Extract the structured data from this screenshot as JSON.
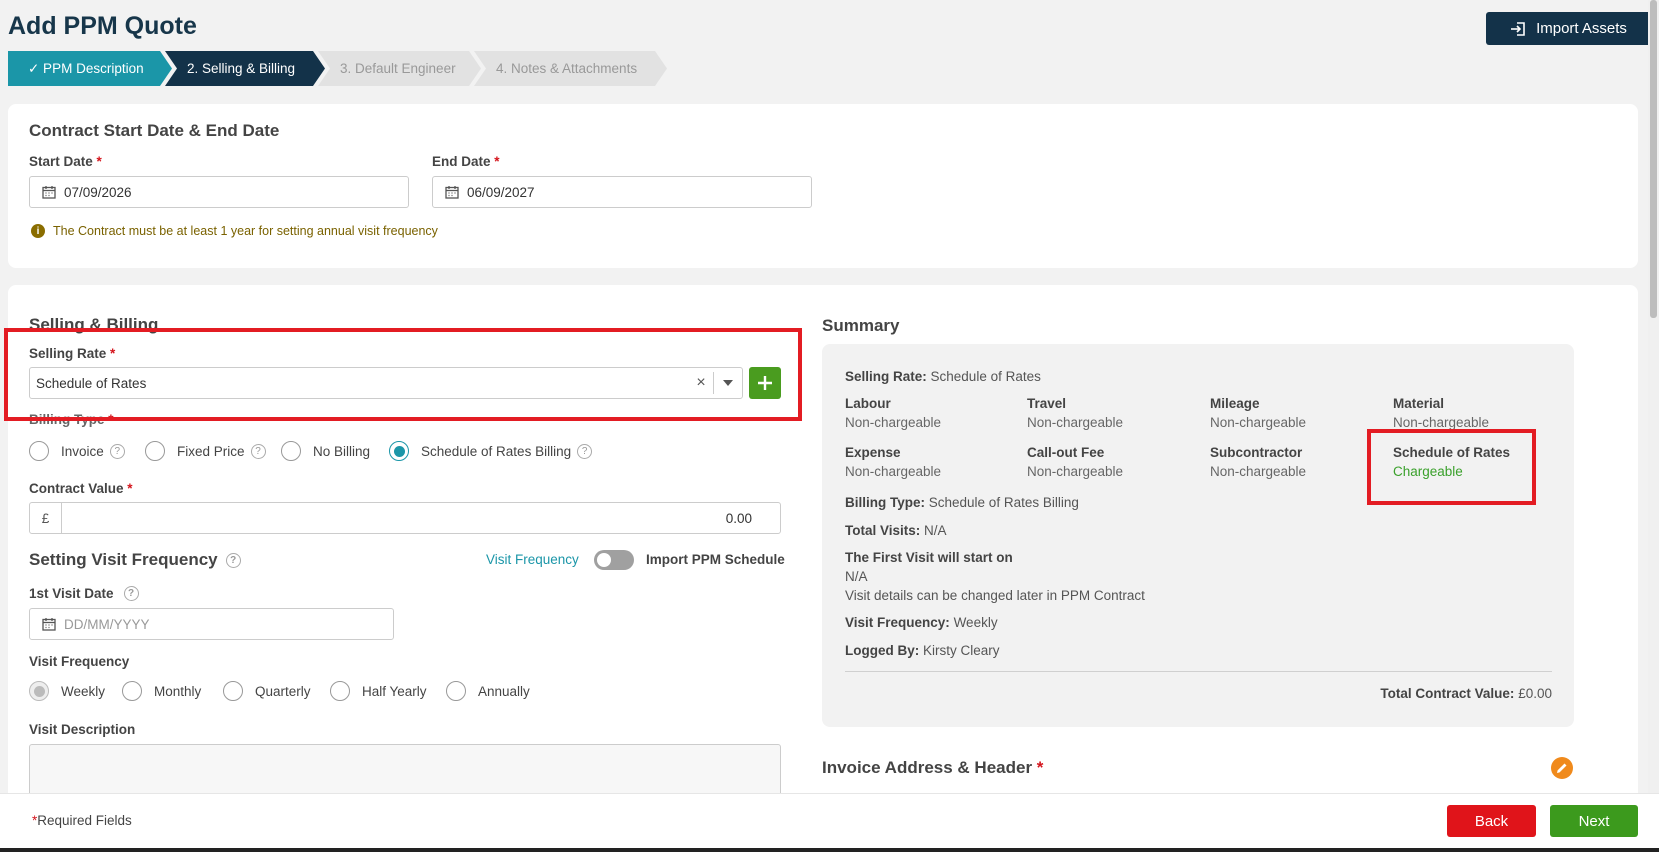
{
  "header": {
    "title": "Add PPM Quote",
    "import_label": "Import Assets"
  },
  "stepper": [
    {
      "label": "✓ PPM Description"
    },
    {
      "label": "2. Selling & Billing"
    },
    {
      "label": "3. Default Engineer"
    },
    {
      "label": "4. Notes & Attachments"
    }
  ],
  "dates": {
    "section_title": "Contract Start Date & End Date",
    "start_label": "Start Date",
    "start_value": "07/09/2026",
    "end_label": "End Date",
    "end_value": "06/09/2027",
    "note": "The Contract must be at least 1 year for setting annual visit frequency",
    "required_mark": "*"
  },
  "selling": {
    "section_title": "Selling & Billing",
    "rate_label": "Selling Rate",
    "rate_value": "Schedule of Rates",
    "billing_type_label": "Billing Type",
    "billing_options": [
      "Invoice",
      "Fixed Price",
      "No Billing",
      "Schedule of Rates Billing"
    ],
    "billing_selected": "Schedule of Rates Billing",
    "contract_value_label": "Contract Value",
    "currency": "£",
    "contract_value": "0.00"
  },
  "visit": {
    "section_title": "Setting Visit Frequency",
    "toggle_left": "Visit Frequency",
    "toggle_right": "Import PPM Schedule",
    "first_visit_label": "1st Visit Date",
    "first_visit_placeholder": "DD/MM/YYYY",
    "frequency_label": "Visit Frequency",
    "frequency_options": [
      "Weekly",
      "Monthly",
      "Quarterly",
      "Half Yearly",
      "Annually"
    ],
    "frequency_selected": "Weekly",
    "description_label": "Visit Description"
  },
  "summary": {
    "title": "Summary",
    "selling_rate_label": "Selling Rate:",
    "selling_rate_value": "Schedule of Rates",
    "grid": [
      {
        "label": "Labour",
        "value": "Non-chargeable"
      },
      {
        "label": "Travel",
        "value": "Non-chargeable"
      },
      {
        "label": "Mileage",
        "value": "Non-chargeable"
      },
      {
        "label": "Material",
        "value": "Non-chargeable"
      },
      {
        "label": "Expense",
        "value": "Non-chargeable"
      },
      {
        "label": "Call-out Fee",
        "value": "Non-chargeable"
      },
      {
        "label": "Subcontractor",
        "value": "Non-chargeable"
      },
      {
        "label": "Schedule of Rates",
        "value": "Chargeable"
      }
    ],
    "billing_type_label": "Billing Type:",
    "billing_type_value": "Schedule of Rates Billing",
    "total_visits_label": "Total Visits:",
    "total_visits_value": "N/A",
    "first_visit_label": "The First Visit will start on",
    "first_visit_value": "N/A",
    "visit_note": "Visit details can be changed later in PPM Contract",
    "visit_freq_label": "Visit Frequency:",
    "visit_freq_value": "Weekly",
    "logged_by_label": "Logged By:",
    "logged_by_value": "Kirsty Cleary",
    "total_label": "Total Contract Value:",
    "total_value": "£0.00"
  },
  "invoice": {
    "title": "Invoice Address & Header"
  },
  "footer": {
    "required_note": "Required Fields",
    "back_label": "Back",
    "next_label": "Next"
  },
  "colors": {
    "primary_dark": "#133249",
    "teal": "#1b96a8",
    "required_red": "#d4131b",
    "add_green": "#4a9c1f",
    "chargeable_green": "#3aa02b",
    "highlight_red": "#e31c23",
    "edit_orange": "#f08a1c"
  }
}
